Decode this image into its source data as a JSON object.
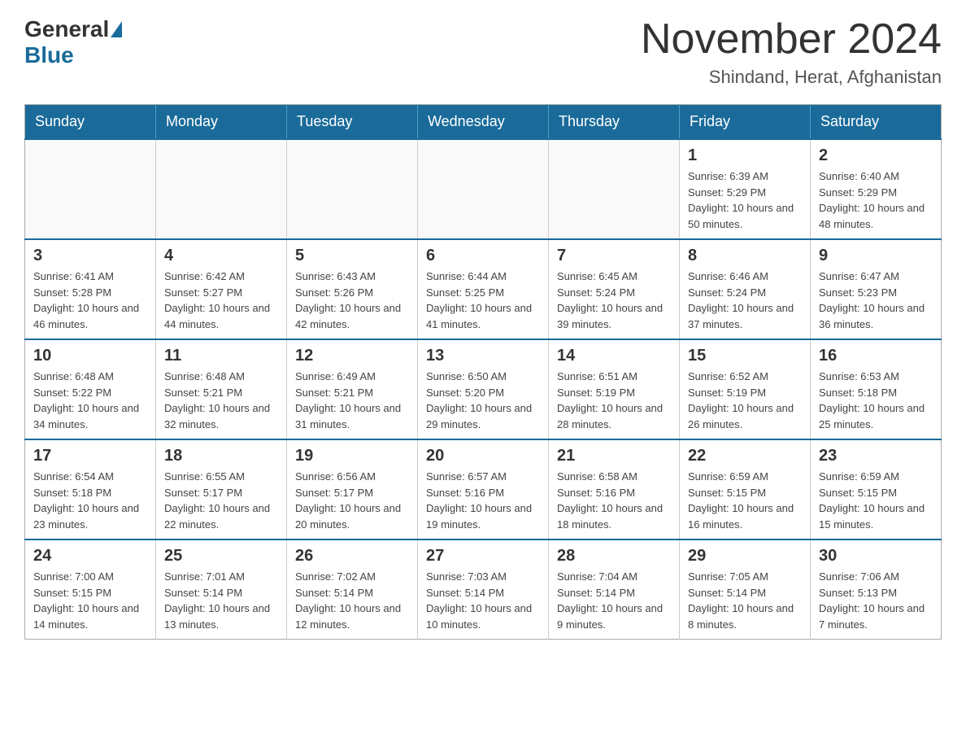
{
  "logo": {
    "general": "General",
    "blue": "Blue"
  },
  "header": {
    "month_title": "November 2024",
    "location": "Shindand, Herat, Afghanistan"
  },
  "weekdays": [
    "Sunday",
    "Monday",
    "Tuesday",
    "Wednesday",
    "Thursday",
    "Friday",
    "Saturday"
  ],
  "weeks": [
    [
      {
        "day": "",
        "info": ""
      },
      {
        "day": "",
        "info": ""
      },
      {
        "day": "",
        "info": ""
      },
      {
        "day": "",
        "info": ""
      },
      {
        "day": "",
        "info": ""
      },
      {
        "day": "1",
        "info": "Sunrise: 6:39 AM\nSunset: 5:29 PM\nDaylight: 10 hours and 50 minutes."
      },
      {
        "day": "2",
        "info": "Sunrise: 6:40 AM\nSunset: 5:29 PM\nDaylight: 10 hours and 48 minutes."
      }
    ],
    [
      {
        "day": "3",
        "info": "Sunrise: 6:41 AM\nSunset: 5:28 PM\nDaylight: 10 hours and 46 minutes."
      },
      {
        "day": "4",
        "info": "Sunrise: 6:42 AM\nSunset: 5:27 PM\nDaylight: 10 hours and 44 minutes."
      },
      {
        "day": "5",
        "info": "Sunrise: 6:43 AM\nSunset: 5:26 PM\nDaylight: 10 hours and 42 minutes."
      },
      {
        "day": "6",
        "info": "Sunrise: 6:44 AM\nSunset: 5:25 PM\nDaylight: 10 hours and 41 minutes."
      },
      {
        "day": "7",
        "info": "Sunrise: 6:45 AM\nSunset: 5:24 PM\nDaylight: 10 hours and 39 minutes."
      },
      {
        "day": "8",
        "info": "Sunrise: 6:46 AM\nSunset: 5:24 PM\nDaylight: 10 hours and 37 minutes."
      },
      {
        "day": "9",
        "info": "Sunrise: 6:47 AM\nSunset: 5:23 PM\nDaylight: 10 hours and 36 minutes."
      }
    ],
    [
      {
        "day": "10",
        "info": "Sunrise: 6:48 AM\nSunset: 5:22 PM\nDaylight: 10 hours and 34 minutes."
      },
      {
        "day": "11",
        "info": "Sunrise: 6:48 AM\nSunset: 5:21 PM\nDaylight: 10 hours and 32 minutes."
      },
      {
        "day": "12",
        "info": "Sunrise: 6:49 AM\nSunset: 5:21 PM\nDaylight: 10 hours and 31 minutes."
      },
      {
        "day": "13",
        "info": "Sunrise: 6:50 AM\nSunset: 5:20 PM\nDaylight: 10 hours and 29 minutes."
      },
      {
        "day": "14",
        "info": "Sunrise: 6:51 AM\nSunset: 5:19 PM\nDaylight: 10 hours and 28 minutes."
      },
      {
        "day": "15",
        "info": "Sunrise: 6:52 AM\nSunset: 5:19 PM\nDaylight: 10 hours and 26 minutes."
      },
      {
        "day": "16",
        "info": "Sunrise: 6:53 AM\nSunset: 5:18 PM\nDaylight: 10 hours and 25 minutes."
      }
    ],
    [
      {
        "day": "17",
        "info": "Sunrise: 6:54 AM\nSunset: 5:18 PM\nDaylight: 10 hours and 23 minutes."
      },
      {
        "day": "18",
        "info": "Sunrise: 6:55 AM\nSunset: 5:17 PM\nDaylight: 10 hours and 22 minutes."
      },
      {
        "day": "19",
        "info": "Sunrise: 6:56 AM\nSunset: 5:17 PM\nDaylight: 10 hours and 20 minutes."
      },
      {
        "day": "20",
        "info": "Sunrise: 6:57 AM\nSunset: 5:16 PM\nDaylight: 10 hours and 19 minutes."
      },
      {
        "day": "21",
        "info": "Sunrise: 6:58 AM\nSunset: 5:16 PM\nDaylight: 10 hours and 18 minutes."
      },
      {
        "day": "22",
        "info": "Sunrise: 6:59 AM\nSunset: 5:15 PM\nDaylight: 10 hours and 16 minutes."
      },
      {
        "day": "23",
        "info": "Sunrise: 6:59 AM\nSunset: 5:15 PM\nDaylight: 10 hours and 15 minutes."
      }
    ],
    [
      {
        "day": "24",
        "info": "Sunrise: 7:00 AM\nSunset: 5:15 PM\nDaylight: 10 hours and 14 minutes."
      },
      {
        "day": "25",
        "info": "Sunrise: 7:01 AM\nSunset: 5:14 PM\nDaylight: 10 hours and 13 minutes."
      },
      {
        "day": "26",
        "info": "Sunrise: 7:02 AM\nSunset: 5:14 PM\nDaylight: 10 hours and 12 minutes."
      },
      {
        "day": "27",
        "info": "Sunrise: 7:03 AM\nSunset: 5:14 PM\nDaylight: 10 hours and 10 minutes."
      },
      {
        "day": "28",
        "info": "Sunrise: 7:04 AM\nSunset: 5:14 PM\nDaylight: 10 hours and 9 minutes."
      },
      {
        "day": "29",
        "info": "Sunrise: 7:05 AM\nSunset: 5:14 PM\nDaylight: 10 hours and 8 minutes."
      },
      {
        "day": "30",
        "info": "Sunrise: 7:06 AM\nSunset: 5:13 PM\nDaylight: 10 hours and 7 minutes."
      }
    ]
  ]
}
